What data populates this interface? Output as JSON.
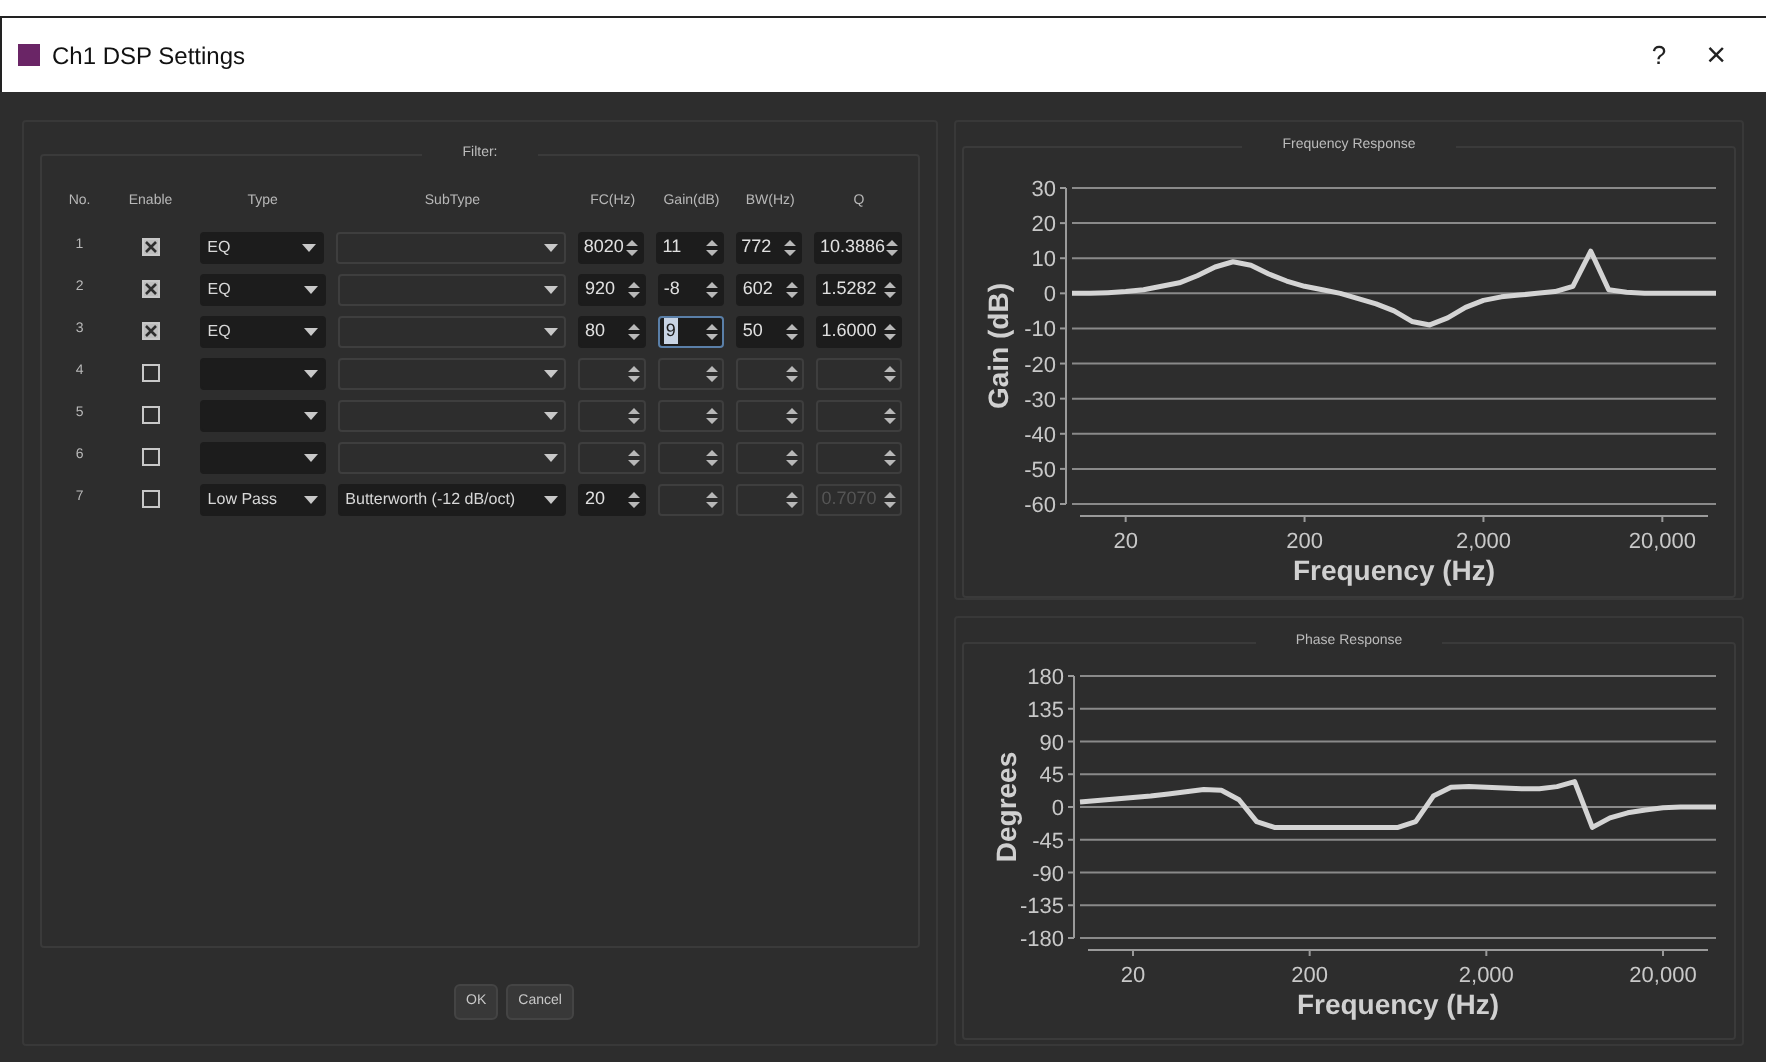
{
  "window": {
    "title": "Ch1 DSP Settings",
    "help": "?",
    "close": "×"
  },
  "filter": {
    "title": "Filter:",
    "columns": [
      "No.",
      "Enable",
      "Type",
      "SubType",
      "FC(Hz)",
      "Gain(dB)",
      "BW(Hz)",
      "Q"
    ],
    "rows": [
      {
        "no": "1",
        "enabled": true,
        "type": {
          "value": "EQ",
          "disabled": false
        },
        "subtype": {
          "disabled": true
        },
        "fc": {
          "value": "8020",
          "disabled": false
        },
        "gain": {
          "value": "11",
          "disabled": false,
          "focused": false
        },
        "bw": {
          "value": "772",
          "disabled": false
        },
        "q": {
          "value": "10.3886",
          "disabled": false
        }
      },
      {
        "no": "2",
        "enabled": true,
        "type": {
          "value": "EQ",
          "disabled": false
        },
        "subtype": {
          "disabled": true
        },
        "fc": {
          "value": "920",
          "disabled": false
        },
        "gain": {
          "value": "-8",
          "disabled": false,
          "focused": false
        },
        "bw": {
          "value": "602",
          "disabled": false
        },
        "q": {
          "value": "1.5282",
          "disabled": false
        }
      },
      {
        "no": "3",
        "enabled": true,
        "type": {
          "value": "EQ",
          "disabled": false
        },
        "subtype": {
          "disabled": true
        },
        "fc": {
          "value": "80",
          "disabled": false
        },
        "gain": {
          "value": "9",
          "disabled": false,
          "focused": true
        },
        "bw": {
          "value": "50",
          "disabled": false
        },
        "q": {
          "value": "1.6000",
          "disabled": false
        }
      },
      {
        "no": "4",
        "enabled": false,
        "type": {
          "disabled": false
        },
        "subtype": {
          "disabled": true
        },
        "fc": {
          "disabled": true
        },
        "gain": {
          "disabled": true,
          "focused": false
        },
        "bw": {
          "disabled": true
        },
        "q": {
          "disabled": true
        }
      },
      {
        "no": "5",
        "enabled": false,
        "type": {
          "disabled": false
        },
        "subtype": {
          "disabled": true
        },
        "fc": {
          "disabled": true
        },
        "gain": {
          "disabled": true,
          "focused": false
        },
        "bw": {
          "disabled": true
        },
        "q": {
          "disabled": true
        }
      },
      {
        "no": "6",
        "enabled": false,
        "type": {
          "disabled": false
        },
        "subtype": {
          "disabled": true
        },
        "fc": {
          "disabled": true
        },
        "gain": {
          "disabled": true,
          "focused": false
        },
        "bw": {
          "disabled": true
        },
        "q": {
          "disabled": true
        }
      },
      {
        "no": "7",
        "enabled": false,
        "type": {
          "value": "Low Pass",
          "disabled": false
        },
        "subtype": {
          "value": "Butterworth (-12 dB/oct)",
          "disabled": false
        },
        "fc": {
          "value": "20",
          "disabled": false
        },
        "gain": {
          "disabled": true,
          "focused": false
        },
        "bw": {
          "disabled": true
        },
        "q": {
          "value": "0.7070",
          "disabled": true
        }
      }
    ]
  },
  "buttons": [
    "OK",
    "Cancel"
  ],
  "frequency_response": {
    "chart_data": {
      "type": "line",
      "title": "Frequency Response",
      "xlabel": "Frequency (Hz)",
      "ylabel": "Gain (dB)",
      "categories": [
        null,
        null,
        null,
        "20",
        null,
        null,
        null,
        null,
        null,
        null,
        null,
        null,
        null,
        "200",
        null,
        null,
        null,
        null,
        null,
        null,
        null,
        null,
        null,
        "2,000",
        null,
        null,
        null,
        null,
        null,
        null,
        null,
        null,
        null,
        "20,000",
        null,
        null,
        null
      ],
      "series": [
        {
          "color": "#d4d4d4",
          "values": [
            0,
            0,
            0.2,
            0.5,
            1,
            2,
            3,
            5,
            7.5,
            9,
            8,
            5.5,
            3.5,
            2,
            1,
            0,
            -1.5,
            -3,
            -5,
            -8,
            -9,
            -7,
            -4,
            -2,
            -1,
            -0.5,
            0,
            0.5,
            2,
            12,
            1,
            0.3,
            0,
            0,
            0,
            0,
            0
          ]
        }
      ],
      "ylim": [
        -60,
        30
      ],
      "grid": true,
      "yticks": [
        30,
        20,
        10,
        0,
        -10,
        -20,
        -30,
        -40,
        -50,
        -60
      ]
    }
  },
  "phase_response": {
    "chart_data": {
      "type": "line",
      "title": "Phase Response",
      "xlabel": "Frequency (Hz)",
      "ylabel": "Degrees",
      "categories": [
        null,
        null,
        null,
        "20",
        null,
        null,
        null,
        null,
        null,
        null,
        null,
        null,
        null,
        "200",
        null,
        null,
        null,
        null,
        null,
        null,
        null,
        null,
        null,
        "2,000",
        null,
        null,
        null,
        null,
        null,
        null,
        null,
        null,
        null,
        "20,000",
        null,
        null,
        null
      ],
      "series": [
        {
          "color": "#d4d4d4",
          "values": [
            7,
            9,
            11,
            13,
            15,
            18,
            21,
            24,
            23,
            10,
            -20,
            -28,
            -28,
            -28,
            -28,
            -28,
            -28,
            -28,
            -28,
            -20,
            15,
            27,
            28,
            27,
            26,
            25,
            25,
            28,
            35,
            -28,
            -15,
            -8,
            -4,
            -1,
            0,
            0,
            0
          ]
        }
      ],
      "ylim": [
        -180,
        180
      ],
      "grid": true,
      "yticks": [
        180,
        135,
        90,
        45,
        0,
        -45,
        -90,
        -135,
        -180
      ]
    }
  }
}
